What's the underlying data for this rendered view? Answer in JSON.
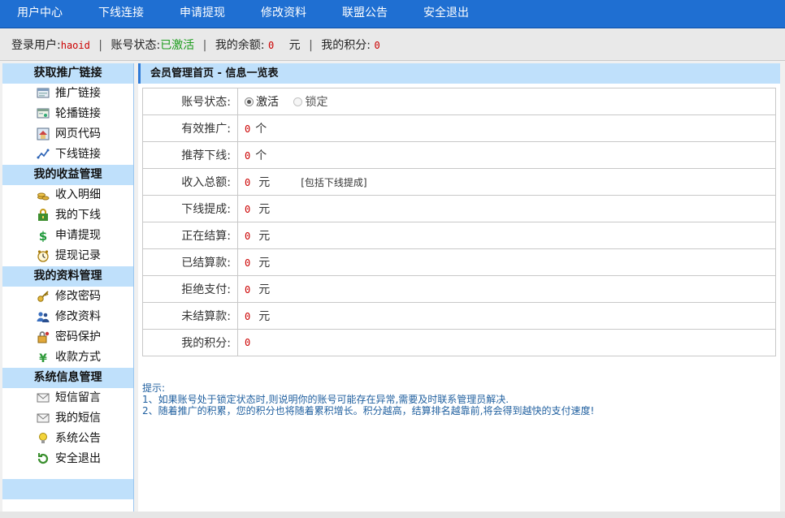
{
  "nav": {
    "items": [
      {
        "label": "用户中心"
      },
      {
        "label": "下线连接"
      },
      {
        "label": "申请提现"
      },
      {
        "label": "修改资料"
      },
      {
        "label": "联盟公告"
      },
      {
        "label": "安全退出"
      }
    ]
  },
  "status": {
    "user_label": "登录用户:",
    "user_value": "haoid",
    "account_label": "账号状态:",
    "account_value": "已激活",
    "balance_label": "我的余额:",
    "balance_value": "0",
    "balance_unit": "元",
    "points_label": "我的积分:",
    "points_value": "0",
    "separator": "|"
  },
  "sidebar": {
    "groups": [
      {
        "title": "获取推广链接",
        "items": [
          {
            "label": "推广链接",
            "icon": "window-icon"
          },
          {
            "label": "轮播链接",
            "icon": "slides-icon"
          },
          {
            "label": "网页代码",
            "icon": "home-icon"
          },
          {
            "label": "下线链接",
            "icon": "chart-icon"
          }
        ]
      },
      {
        "title": "我的收益管理",
        "items": [
          {
            "label": "收入明细",
            "icon": "coins-icon"
          },
          {
            "label": "我的下线",
            "icon": "lock-icon"
          },
          {
            "label": "申请提现",
            "icon": "dollar-icon"
          },
          {
            "label": "提现记录",
            "icon": "clock-icon"
          }
        ]
      },
      {
        "title": "我的资料管理",
        "items": [
          {
            "label": "修改密码",
            "icon": "key-icon"
          },
          {
            "label": "修改资料",
            "icon": "users-icon"
          },
          {
            "label": "密码保护",
            "icon": "padlock-icon"
          },
          {
            "label": "收款方式",
            "icon": "yen-icon"
          }
        ]
      },
      {
        "title": "系统信息管理",
        "items": [
          {
            "label": "短信留言",
            "icon": "mail-icon"
          },
          {
            "label": "我的短信",
            "icon": "mail-icon"
          },
          {
            "label": "系统公告",
            "icon": "bulb-icon"
          },
          {
            "label": "安全退出",
            "icon": "exit-icon"
          }
        ]
      }
    ]
  },
  "main": {
    "header": "会员管理首页 - 信息一览表",
    "rows": {
      "account_status": {
        "label": "账号状态:",
        "option_on": "激活",
        "option_off": "锁定"
      },
      "valid_promo": {
        "label": "有效推广:",
        "value": "0",
        "unit": "个"
      },
      "referrals": {
        "label": "推荐下线:",
        "value": "0",
        "unit": "个"
      },
      "income_total": {
        "label": "收入总额:",
        "value": "0",
        "unit": "元",
        "note": "[包括下线提成]"
      },
      "downline_commission": {
        "label": "下线提成:",
        "value": "0",
        "unit": "元"
      },
      "settling": {
        "label": "正在结算:",
        "value": "0",
        "unit": "元"
      },
      "settled": {
        "label": "已结算款:",
        "value": "0",
        "unit": "元"
      },
      "rejected": {
        "label": "拒绝支付:",
        "value": "0",
        "unit": "元"
      },
      "unsettled": {
        "label": "未结算款:",
        "value": "0",
        "unit": "元"
      },
      "points": {
        "label": "我的积分:",
        "value": "0"
      }
    },
    "tips": {
      "title": "提示:",
      "line1": "1、如果账号处于锁定状态时,则说明你的账号可能存在异常,需要及时联系管理员解决.",
      "line2": "2、随着推广的积累，您的积分也将随着累积增长。积分越高，结算排名越靠前,将会得到越快的支付速度!"
    }
  },
  "colors": {
    "nav_bg": "#1f6fd2",
    "sidebar_header_bg": "#bfe0fb",
    "value_red": "#c00",
    "active_green": "#1a9c1a",
    "tip_blue": "#1f5f9f"
  }
}
